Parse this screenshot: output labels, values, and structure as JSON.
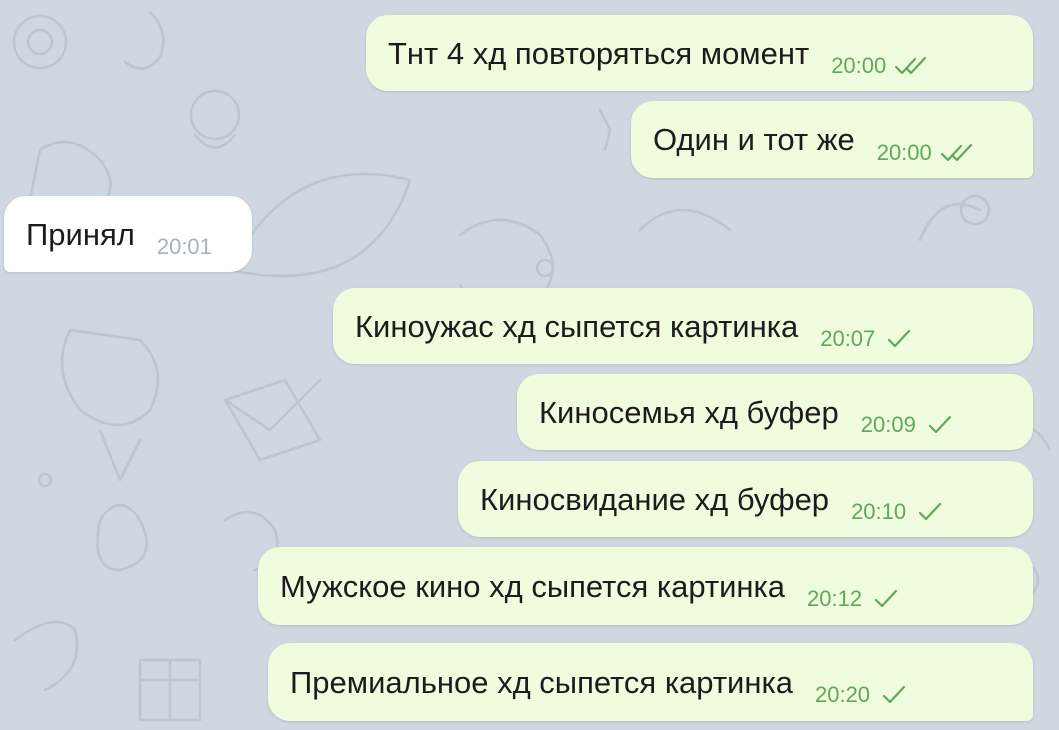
{
  "chat": {
    "messages": [
      {
        "text": "Тнт 4 хд повторяться момент",
        "time": "20:00",
        "direction": "out",
        "status": "read"
      },
      {
        "text": "Один и тот же",
        "time": "20:00",
        "direction": "out",
        "status": "read"
      },
      {
        "text": "Принял",
        "time": "20:01",
        "direction": "in",
        "status": ""
      },
      {
        "text": "Киноужас хд сыпется картинка",
        "time": "20:07",
        "direction": "out",
        "status": "sent"
      },
      {
        "text": "Киносемья хд буфер",
        "time": "20:09",
        "direction": "out",
        "status": "sent"
      },
      {
        "text": "Киносвидание хд буфер",
        "time": "20:10",
        "direction": "out",
        "status": "sent"
      },
      {
        "text": "Мужское кино хд сыпется картинка",
        "time": "20:12",
        "direction": "out",
        "status": "sent"
      },
      {
        "text": "Премиальное хд сыпется картинка",
        "time": "20:20",
        "direction": "out",
        "status": "sent"
      }
    ]
  },
  "colors": {
    "background": "#cfd7e0",
    "outgoing_bubble": "#effdde",
    "incoming_bubble": "#ffffff",
    "outgoing_time": "#5fa85a",
    "incoming_time": "#a8b1ba",
    "check_mark": "#5fa85a"
  },
  "icons": {
    "read_status": "double-check-icon",
    "sent_status": "single-check-icon"
  }
}
